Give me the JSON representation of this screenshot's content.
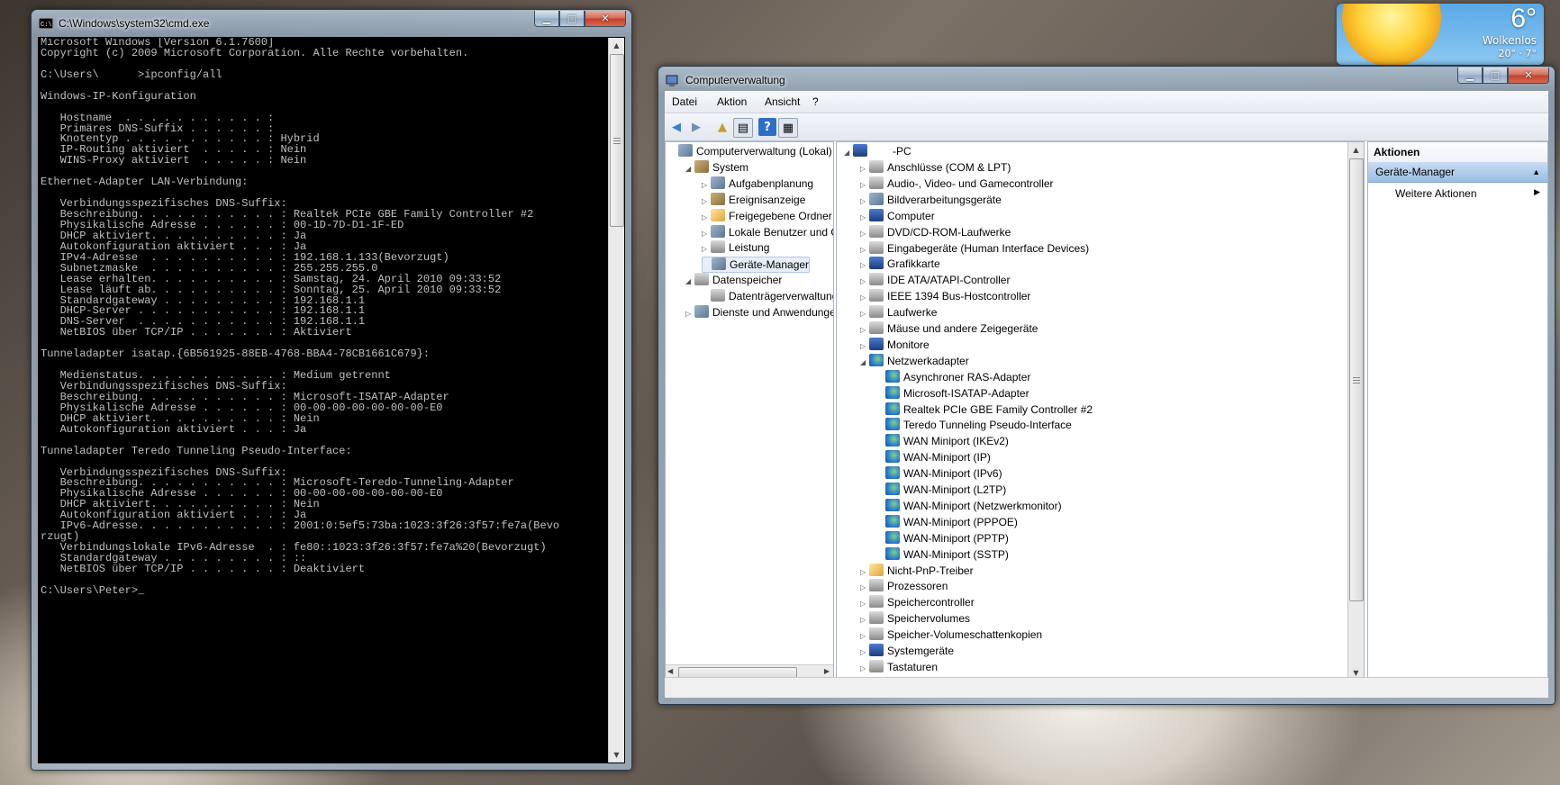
{
  "weather": {
    "temperature": "6°",
    "condition": "Wolkenlos",
    "range": "20° · 7°"
  },
  "cmd": {
    "title": "C:\\Windows\\system32\\cmd.exe",
    "lines": [
      "Microsoft Windows [Version 6.1.7600]",
      "Copyright (c) 2009 Microsoft Corporation. Alle Rechte vorbehalten.",
      "",
      "C:\\Users\\      >ipconfig/all",
      "",
      "Windows-IP-Konfiguration",
      "",
      "   Hostname  . . . . . . . . . . . :",
      "   Primäres DNS-Suffix . . . . . . :",
      "   Knotentyp . . . . . . . . . . . : Hybrid",
      "   IP-Routing aktiviert  . . . . . : Nein",
      "   WINS-Proxy aktiviert  . . . . . : Nein",
      "",
      "Ethernet-Adapter LAN-Verbindung:",
      "",
      "   Verbindungsspezifisches DNS-Suffix:",
      "   Beschreibung. . . . . . . . . . . : Realtek PCIe GBE Family Controller #2",
      "   Physikalische Adresse . . . . . . : 00-1D-7D-D1-1F-ED",
      "   DHCP aktiviert. . . . . . . . . . : Ja",
      "   Autokonfiguration aktiviert . . . : Ja",
      "   IPv4-Adresse  . . . . . . . . . . : 192.168.1.133(Bevorzugt)",
      "   Subnetzmaske  . . . . . . . . . . : 255.255.255.0",
      "   Lease erhalten. . . . . . . . . . : Samstag, 24. April 2010 09:33:52",
      "   Lease läuft ab. . . . . . . . . . : Sonntag, 25. April 2010 09:33:52",
      "   Standardgateway . . . . . . . . . : 192.168.1.1",
      "   DHCP-Server . . . . . . . . . . . : 192.168.1.1",
      "   DNS-Server  . . . . . . . . . . . : 192.168.1.1",
      "   NetBIOS über TCP/IP . . . . . . . : Aktiviert",
      "",
      "Tunneladapter isatap.{6B561925-88EB-4768-BBA4-78CB1661C679}:",
      "",
      "   Medienstatus. . . . . . . . . . . : Medium getrennt",
      "   Verbindungsspezifisches DNS-Suffix:",
      "   Beschreibung. . . . . . . . . . . : Microsoft-ISATAP-Adapter",
      "   Physikalische Adresse . . . . . . : 00-00-00-00-00-00-00-E0",
      "   DHCP aktiviert. . . . . . . . . . : Nein",
      "   Autokonfiguration aktiviert . . . : Ja",
      "",
      "Tunneladapter Teredo Tunneling Pseudo-Interface:",
      "",
      "   Verbindungsspezifisches DNS-Suffix:",
      "   Beschreibung. . . . . . . . . . . : Microsoft-Teredo-Tunneling-Adapter",
      "   Physikalische Adresse . . . . . . : 00-00-00-00-00-00-00-E0",
      "   DHCP aktiviert. . . . . . . . . . : Nein",
      "   Autokonfiguration aktiviert . . . : Ja",
      "   IPv6-Adresse. . . . . . . . . . . : 2001:0:5ef5:73ba:1023:3f26:3f57:fe7a(Bevo",
      "rzugt)",
      "   Verbindungslokale IPv6-Adresse  . : fe80::1023:3f26:3f57:fe7a%20(Bevorzugt)",
      "   Standardgateway . . . . . . . . . : ::",
      "   NetBIOS über TCP/IP . . . . . . . : Deaktiviert",
      "",
      "C:\\Users\\Peter>_"
    ]
  },
  "mmc": {
    "title": "Computerverwaltung",
    "menu": [
      "Datei",
      "Aktion",
      "Ansicht",
      "?"
    ],
    "tree": [
      {
        "label": "Computerverwaltung (Lokal)",
        "level": 0,
        "expander": "",
        "icon": "computer-management-icon",
        "cls": "ok"
      },
      {
        "label": "System",
        "level": 1,
        "expander": "◢",
        "icon": "system-tools-icon",
        "cls": "sys"
      },
      {
        "label": "Aufgabenplanung",
        "level": 2,
        "expander": "▷",
        "icon": "task-scheduler-icon",
        "cls": "ok"
      },
      {
        "label": "Ereignisanzeige",
        "level": 2,
        "expander": "▷",
        "icon": "event-viewer-icon",
        "cls": "sys"
      },
      {
        "label": "Freigegebene Ordner",
        "level": 2,
        "expander": "▷",
        "icon": "shared-folders-icon",
        "cls": "warn"
      },
      {
        "label": "Lokale Benutzer und Gr",
        "level": 2,
        "expander": "▷",
        "icon": "local-users-icon",
        "cls": "ok"
      },
      {
        "label": "Leistung",
        "level": 2,
        "expander": "▷",
        "icon": "performance-icon",
        "cls": "drv"
      },
      {
        "label": "Geräte-Manager",
        "level": 2,
        "expander": "",
        "icon": "device-manager-icon",
        "cls": "ok",
        "selected": true
      },
      {
        "label": "Datenspeicher",
        "level": 1,
        "expander": "◢",
        "icon": "storage-icon",
        "cls": "drv"
      },
      {
        "label": "Datenträgerverwaltung",
        "level": 2,
        "expander": "",
        "icon": "disk-management-icon",
        "cls": "drv"
      },
      {
        "label": "Dienste und Anwendungen",
        "level": 1,
        "expander": "▷",
        "icon": "services-icon",
        "cls": "ok"
      }
    ],
    "device_root": "-PC",
    "devices": [
      {
        "label": "Anschlüsse (COM & LPT)",
        "level": 1,
        "expander": "▷",
        "icon": "port-icon",
        "cls": "drv"
      },
      {
        "label": "Audio-, Video- und Gamecontroller",
        "level": 1,
        "expander": "▷",
        "icon": "speaker-icon",
        "cls": "drv"
      },
      {
        "label": "Bildverarbeitungsgeräte",
        "level": 1,
        "expander": "▷",
        "icon": "camera-icon",
        "cls": "ok"
      },
      {
        "label": "Computer",
        "level": 1,
        "expander": "▷",
        "icon": "computer-icon",
        "cls": "mon"
      },
      {
        "label": "DVD/CD-ROM-Laufwerke",
        "level": 1,
        "expander": "▷",
        "icon": "dvd-icon",
        "cls": "drv"
      },
      {
        "label": "Eingabegeräte (Human Interface Devices)",
        "level": 1,
        "expander": "▷",
        "icon": "hid-icon",
        "cls": "drv"
      },
      {
        "label": "Grafikkarte",
        "level": 1,
        "expander": "▷",
        "icon": "display-adapter-icon",
        "cls": "mon"
      },
      {
        "label": "IDE ATA/ATAPI-Controller",
        "level": 1,
        "expander": "▷",
        "icon": "ide-icon",
        "cls": "drv"
      },
      {
        "label": "IEEE 1394 Bus-Hostcontroller",
        "level": 1,
        "expander": "▷",
        "icon": "firewire-icon",
        "cls": "drv"
      },
      {
        "label": "Laufwerke",
        "level": 1,
        "expander": "▷",
        "icon": "drive-icon",
        "cls": "drv"
      },
      {
        "label": "Mäuse und andere Zeigegeräte",
        "level": 1,
        "expander": "▷",
        "icon": "mouse-icon",
        "cls": "drv"
      },
      {
        "label": "Monitore",
        "level": 1,
        "expander": "▷",
        "icon": "monitor-icon",
        "cls": "mon"
      },
      {
        "label": "Netzwerkadapter",
        "level": 1,
        "expander": "◢",
        "icon": "network-adapter-icon",
        "cls": "net"
      },
      {
        "label": "Asynchroner RAS-Adapter",
        "level": 2,
        "expander": "",
        "icon": "network-adapter-icon",
        "cls": "net"
      },
      {
        "label": "Microsoft-ISATAP-Adapter",
        "level": 2,
        "expander": "",
        "icon": "network-adapter-icon",
        "cls": "net"
      },
      {
        "label": "Realtek PCIe GBE Family Controller #2",
        "level": 2,
        "expander": "",
        "icon": "network-adapter-icon",
        "cls": "net"
      },
      {
        "label": "Teredo Tunneling Pseudo-Interface",
        "level": 2,
        "expander": "",
        "icon": "network-adapter-icon",
        "cls": "net"
      },
      {
        "label": "WAN Miniport (IKEv2)",
        "level": 2,
        "expander": "",
        "icon": "network-adapter-icon",
        "cls": "net"
      },
      {
        "label": "WAN-Miniport (IP)",
        "level": 2,
        "expander": "",
        "icon": "network-adapter-icon",
        "cls": "net"
      },
      {
        "label": "WAN-Miniport (IPv6)",
        "level": 2,
        "expander": "",
        "icon": "network-adapter-icon",
        "cls": "net"
      },
      {
        "label": "WAN-Miniport (L2TP)",
        "level": 2,
        "expander": "",
        "icon": "network-adapter-icon",
        "cls": "net"
      },
      {
        "label": "WAN-Miniport (Netzwerkmonitor)",
        "level": 2,
        "expander": "",
        "icon": "network-adapter-icon",
        "cls": "net"
      },
      {
        "label": "WAN-Miniport (PPPOE)",
        "level": 2,
        "expander": "",
        "icon": "network-adapter-icon",
        "cls": "net"
      },
      {
        "label": "WAN-Miniport (PPTP)",
        "level": 2,
        "expander": "",
        "icon": "network-adapter-icon",
        "cls": "net"
      },
      {
        "label": "WAN-Miniport (SSTP)",
        "level": 2,
        "expander": "",
        "icon": "network-adapter-icon",
        "cls": "net"
      },
      {
        "label": "Nicht-PnP-Treiber",
        "level": 1,
        "expander": "▷",
        "icon": "non-pnp-driver-icon",
        "cls": "warn"
      },
      {
        "label": "Prozessoren",
        "level": 1,
        "expander": "▷",
        "icon": "processor-icon",
        "cls": "drv"
      },
      {
        "label": "Speichercontroller",
        "level": 1,
        "expander": "▷",
        "icon": "storage-controller-icon",
        "cls": "drv"
      },
      {
        "label": "Speichervolumes",
        "level": 1,
        "expander": "▷",
        "icon": "volume-icon",
        "cls": "drv"
      },
      {
        "label": "Speicher-Volumeschattenkopien",
        "level": 1,
        "expander": "▷",
        "icon": "shadow-copy-icon",
        "cls": "drv"
      },
      {
        "label": "Systemgeräte",
        "level": 1,
        "expander": "▷",
        "icon": "system-device-icon",
        "cls": "mon"
      },
      {
        "label": "Tastaturen",
        "level": 1,
        "expander": "▷",
        "icon": "keyboard-icon",
        "cls": "drv"
      }
    ],
    "actions": {
      "heading": "Aktionen",
      "section": "Geräte-Manager",
      "more": "Weitere Aktionen"
    }
  }
}
